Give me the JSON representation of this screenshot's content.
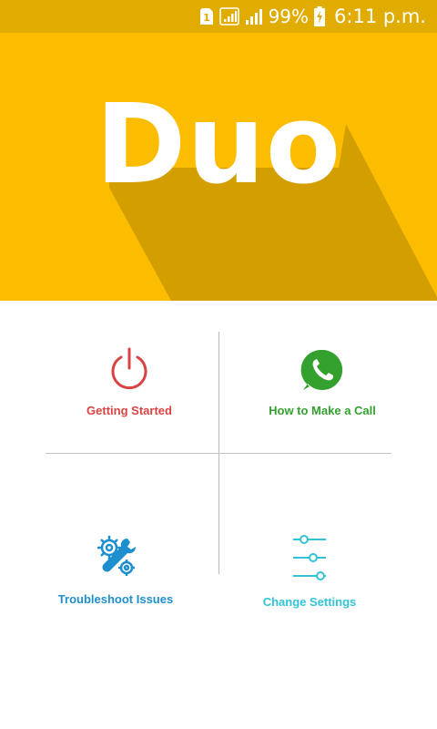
{
  "status_bar": {
    "battery": "99%",
    "time": "6:11 p.m.",
    "sim_label": "1",
    "icons": [
      "sim-icon",
      "signal-icon",
      "signal-icon",
      "battery-charging-icon"
    ]
  },
  "hero": {
    "title": "Duo",
    "colors": {
      "background": "#fcbc00",
      "shadow": "#d39f00",
      "text": "#ffffff"
    }
  },
  "menu": {
    "tiles": [
      {
        "label": "Getting Started",
        "icon": "power-icon",
        "color": "#d94343"
      },
      {
        "label": "How to Make a Call",
        "icon": "whatsapp-phone-icon",
        "color": "#34a12f"
      },
      {
        "label": "Troubleshoot Issues",
        "icon": "gear-wrench-icon",
        "color": "#1e8fce"
      },
      {
        "label": "Change Settings",
        "icon": "sliders-icon",
        "color": "#33c3d6"
      }
    ]
  }
}
